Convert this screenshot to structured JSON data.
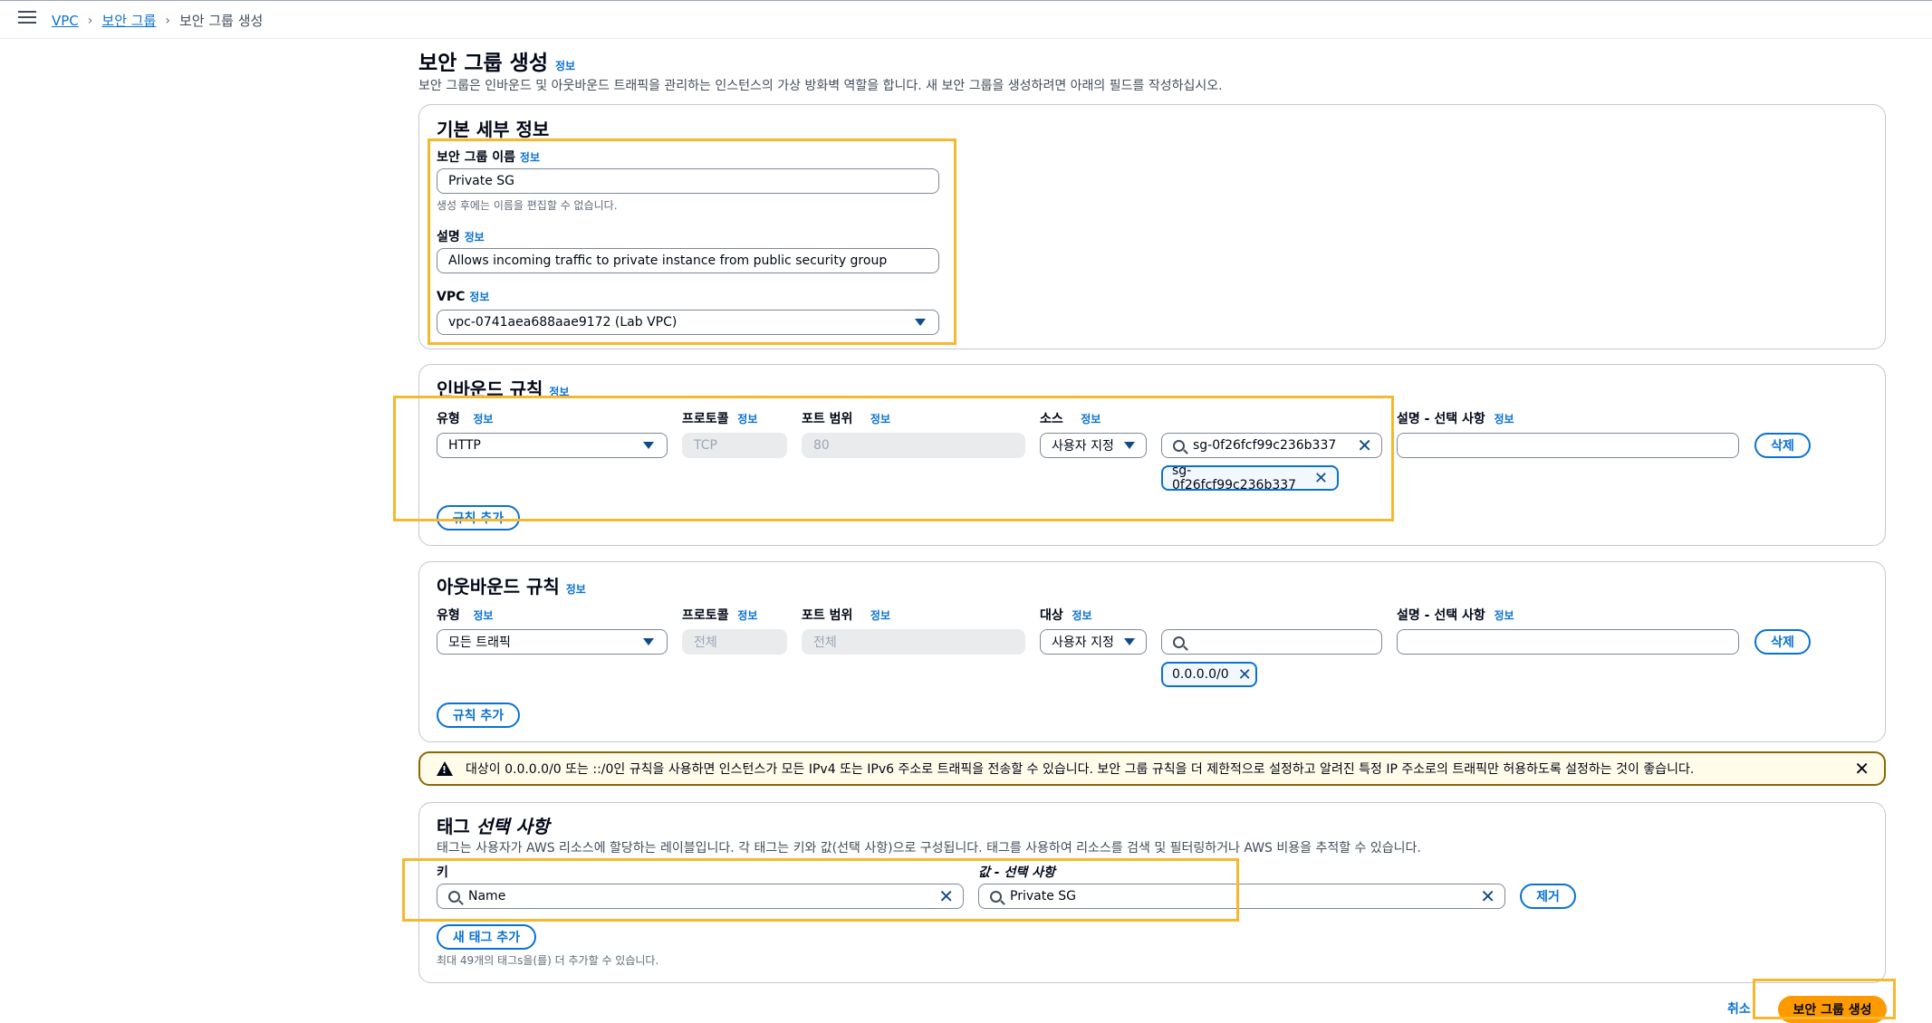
{
  "breadcrumb": {
    "vpc": "VPC",
    "security_groups": "보안 그룹",
    "current": "보안 그룹 생성"
  },
  "page": {
    "title": "보안 그룹 생성",
    "info": "정보",
    "description": "보안 그룹은 인바운드 및 아웃바운드 트래픽을 관리하는 인스턴스의 가상 방화벽 역할을 합니다. 새 보안 그룹을 생성하려면 아래의 필드를 작성하십시오."
  },
  "basic": {
    "title": "기본 세부 정보",
    "name_label": "보안 그룹 이름",
    "name_value": "Private SG",
    "name_hint": "생성 후에는 이름을 편집할 수 없습니다.",
    "desc_label": "설명",
    "desc_value": "Allows incoming traffic to private instance from public security group",
    "vpc_label": "VPC",
    "vpc_value": "vpc-0741aea688aae9172 (Lab VPC)"
  },
  "inbound": {
    "title": "인바운드 규칙",
    "col_type": "유형",
    "col_protocol": "프로토콜",
    "col_port": "포트 범위",
    "col_source": "소스",
    "col_desc": "설명 - 선택 사항",
    "type_value": "HTTP",
    "protocol_value": "TCP",
    "port_value": "80",
    "source_mode": "사용자 지정",
    "source_search": "sg-0f26fcf99c236b337",
    "source_token": "sg-0f26fcf99c236b337",
    "delete": "삭제",
    "add_rule": "규칙 추가"
  },
  "outbound": {
    "title": "아웃바운드 규칙",
    "col_type": "유형",
    "col_protocol": "프로토콜",
    "col_port": "포트 범위",
    "col_dest": "대상",
    "col_desc": "설명 - 선택 사항",
    "type_value": "모든 트래픽",
    "protocol_value": "전체",
    "port_value": "전체",
    "dest_mode": "사용자 지정",
    "dest_token": "0.0.0.0/0",
    "delete": "삭제",
    "add_rule": "규칙 추가"
  },
  "alert": {
    "text": "대상이 0.0.0.0/0 또는 ::/0인 규칙을 사용하면 인스턴스가 모든 IPv4 또는 IPv6 주소로 트래픽을 전송할 수 있습니다. 보안 그룹 규칙을 더 제한적으로 설정하고 알려진 특정 IP 주소로의 트래픽만 허용하도록 설정하는 것이 좋습니다."
  },
  "tags": {
    "title": "태그",
    "title_optional": "선택 사항",
    "description": "태그는 사용자가 AWS 리소스에 할당하는 레이블입니다. 각 태그는 키와 값(선택 사항)으로 구성됩니다. 태그를 사용하여 리소스를 검색 및 필터링하거나 AWS 비용을 추적할 수 있습니다.",
    "key_label": "키",
    "value_label": "값 - 선택 사항",
    "key_value": "Name",
    "value_value": "Private SG",
    "remove": "제거",
    "add_tag": "새 태그 추가",
    "limit_hint": "최대 49개의 태그s을(를) 더 추가할 수 있습니다."
  },
  "footer": {
    "cancel": "취소",
    "create": "보안 그룹 생성"
  },
  "icons": [
    "menu-icon",
    "chevron-right-icon",
    "caret-down-icon",
    "search-icon",
    "close-icon",
    "warning-icon"
  ],
  "colors": {
    "link": "#0972d3",
    "primary": "#ff9900",
    "highlight": "#f5b82e"
  }
}
